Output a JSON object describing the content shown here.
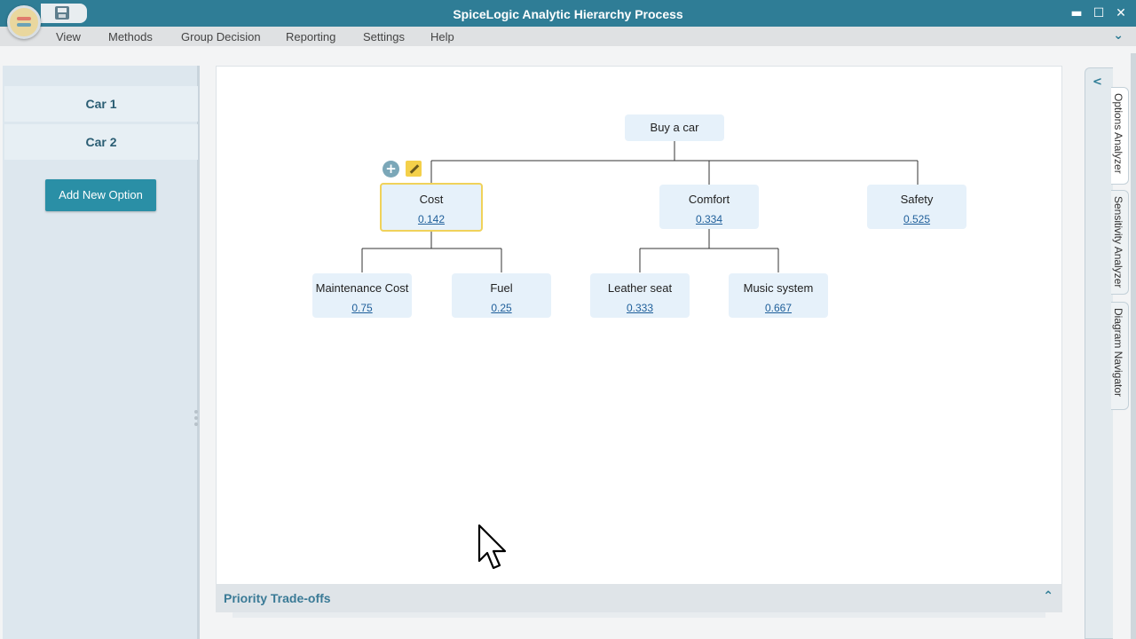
{
  "window": {
    "title": "SpiceLogic Analytic Hierarchy Process",
    "minimize": "▬",
    "maximize": "☐",
    "close": "✕"
  },
  "menu": {
    "items": [
      "View",
      "Methods",
      "Group Decision",
      "Reporting",
      "Settings",
      "Help"
    ],
    "chevron": "⌄"
  },
  "options": {
    "items": [
      "Car 1",
      "Car 2"
    ],
    "add_label": "Add New Option"
  },
  "hierarchy": {
    "goal": "Buy a car",
    "criteria": [
      {
        "name": "Cost",
        "value": "0.142"
      },
      {
        "name": "Comfort",
        "value": "0.334"
      },
      {
        "name": "Safety",
        "value": "0.525"
      }
    ],
    "subcriteria": [
      {
        "name": "Maintenance Cost",
        "value": "0.75"
      },
      {
        "name": "Fuel",
        "value": "0.25"
      },
      {
        "name": "Leather seat",
        "value": "0.333"
      },
      {
        "name": "Music system",
        "value": "0.667"
      }
    ],
    "add_icon": "+"
  },
  "priority": {
    "title": "Priority Trade-offs",
    "toggle": "⌃"
  },
  "side_tabs": {
    "collapse": "<",
    "tabs": [
      "Options Analyzer",
      "Sensitivity Analyzer",
      "Diagram Navigator"
    ]
  },
  "colors": {
    "titlebar": "#2f7d96",
    "node_fill": "#e6f1fa",
    "selected_border": "#f0d25a",
    "button": "#2a8fa6"
  }
}
